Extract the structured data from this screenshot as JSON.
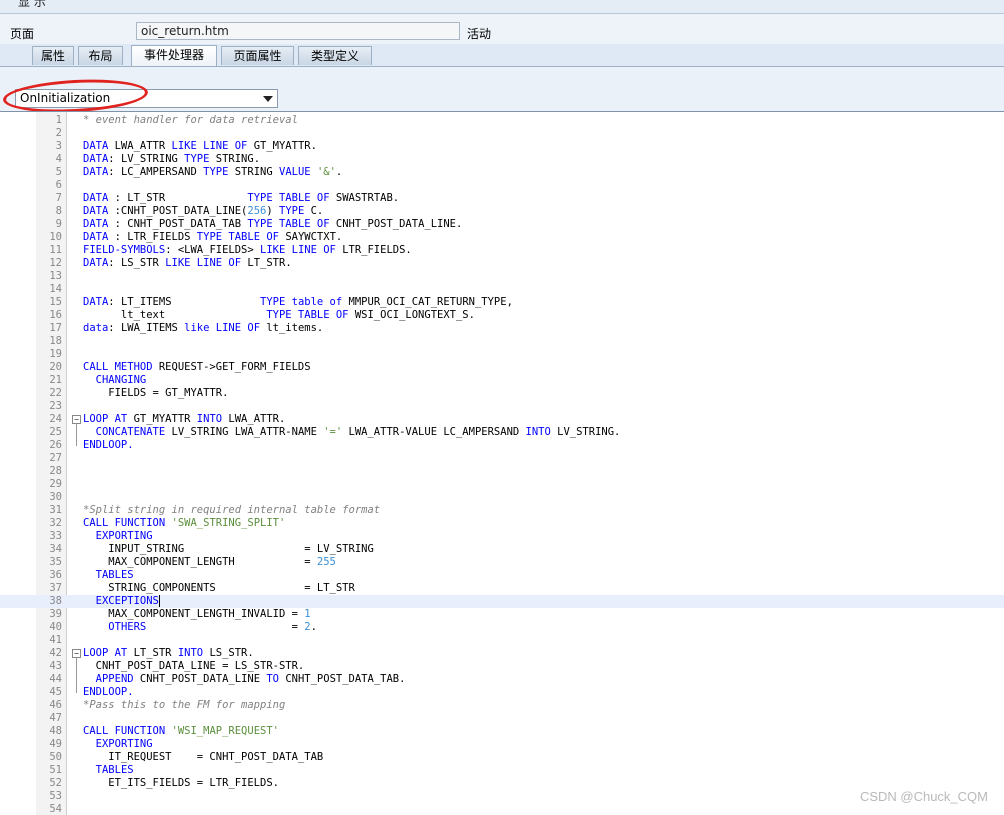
{
  "window": {
    "title": "显 示"
  },
  "header": {
    "page_label": "页面",
    "page_value": "oic_return.htm",
    "status": "活动"
  },
  "tabs": [
    {
      "label": "属性",
      "active": false
    },
    {
      "label": "布局",
      "active": false
    },
    {
      "label": "事件处理器",
      "active": true
    },
    {
      "label": "页面属性",
      "active": false
    },
    {
      "label": "类型定义",
      "active": false
    }
  ],
  "event_select": {
    "value": "OnInitialization"
  },
  "editor": {
    "cursor_line": 38,
    "lines": [
      {
        "n": "1",
        "segs": [
          [
            "c",
            "* event handler for data retrieval"
          ]
        ]
      },
      {
        "n": "2",
        "segs": []
      },
      {
        "n": "3",
        "segs": [
          [
            "k",
            "DATA "
          ],
          [
            "t",
            "LWA_ATTR "
          ],
          [
            "k",
            "LIKE LINE OF "
          ],
          [
            "t",
            "GT_MYATTR."
          ]
        ]
      },
      {
        "n": "4",
        "segs": [
          [
            "k",
            "DATA"
          ],
          [
            "t",
            ": LV_STRING "
          ],
          [
            "k",
            "TYPE "
          ],
          [
            "t",
            "STRING."
          ]
        ]
      },
      {
        "n": "5",
        "segs": [
          [
            "k",
            "DATA"
          ],
          [
            "t",
            ": LC_AMPERSAND "
          ],
          [
            "k",
            "TYPE "
          ],
          [
            "t",
            "STRING "
          ],
          [
            "k",
            "VALUE "
          ],
          [
            "s",
            "'&'"
          ],
          [
            "t",
            "."
          ]
        ]
      },
      {
        "n": "6",
        "segs": []
      },
      {
        "n": "7",
        "segs": [
          [
            "k",
            "DATA "
          ],
          [
            "t",
            ": LT_STR             "
          ],
          [
            "k",
            "TYPE TABLE OF "
          ],
          [
            "t",
            "SWASTRTAB."
          ]
        ]
      },
      {
        "n": "8",
        "segs": [
          [
            "k",
            "DATA "
          ],
          [
            "t",
            ":CNHT_POST_DATA_LINE("
          ],
          [
            "n",
            "256"
          ],
          [
            "t",
            ") "
          ],
          [
            "k",
            "TYPE "
          ],
          [
            "t",
            "C."
          ]
        ]
      },
      {
        "n": "9",
        "segs": [
          [
            "k",
            "DATA "
          ],
          [
            "t",
            ": CNHT_POST_DATA_TAB "
          ],
          [
            "k",
            "TYPE TABLE OF "
          ],
          [
            "t",
            "CNHT_POST_DATA_LINE."
          ]
        ]
      },
      {
        "n": "10",
        "segs": [
          [
            "k",
            "DATA "
          ],
          [
            "t",
            ": LTR_FIELDS "
          ],
          [
            "k",
            "TYPE TABLE OF "
          ],
          [
            "t",
            "SAYWCTXT."
          ]
        ]
      },
      {
        "n": "11",
        "segs": [
          [
            "k",
            "FIELD-SYMBOLS"
          ],
          [
            "t",
            ": <LWA_FIELDS> "
          ],
          [
            "k",
            "LIKE LINE OF "
          ],
          [
            "t",
            "LTR_FIELDS."
          ]
        ]
      },
      {
        "n": "12",
        "segs": [
          [
            "k",
            "DATA"
          ],
          [
            "t",
            ": LS_STR "
          ],
          [
            "k",
            "LIKE LINE OF "
          ],
          [
            "t",
            "LT_STR."
          ]
        ]
      },
      {
        "n": "13",
        "segs": []
      },
      {
        "n": "14",
        "segs": []
      },
      {
        "n": "15",
        "segs": [
          [
            "k",
            "DATA"
          ],
          [
            "t",
            ": LT_ITEMS              "
          ],
          [
            "k",
            "TYPE table of "
          ],
          [
            "t",
            "MMPUR_OCI_CAT_RETURN_TYPE,"
          ]
        ]
      },
      {
        "n": "16",
        "segs": [
          [
            "t",
            "      lt_text                "
          ],
          [
            "k",
            "TYPE TABLE OF "
          ],
          [
            "t",
            "WSI_OCI_LONGTEXT_S."
          ]
        ]
      },
      {
        "n": "17",
        "segs": [
          [
            "k",
            "data"
          ],
          [
            "t",
            ": LWA_ITEMS "
          ],
          [
            "k",
            "like LINE OF "
          ],
          [
            "t",
            "lt_items."
          ]
        ]
      },
      {
        "n": "18",
        "segs": []
      },
      {
        "n": "19",
        "segs": []
      },
      {
        "n": "20",
        "segs": [
          [
            "k",
            "CALL METHOD "
          ],
          [
            "t",
            "REQUEST->GET_FORM_FIELDS"
          ]
        ]
      },
      {
        "n": "21",
        "segs": [
          [
            "t",
            "  "
          ],
          [
            "k",
            "CHANGING"
          ]
        ]
      },
      {
        "n": "22",
        "segs": [
          [
            "t",
            "    FIELDS = GT_MYATTR."
          ]
        ]
      },
      {
        "n": "23",
        "segs": []
      },
      {
        "n": "24",
        "segs": [
          [
            "k",
            "LOOP AT "
          ],
          [
            "t",
            "GT_MYATTR "
          ],
          [
            "k",
            "INTO "
          ],
          [
            "t",
            "LWA_ATTR."
          ]
        ]
      },
      {
        "n": "25",
        "segs": [
          [
            "t",
            "  "
          ],
          [
            "k",
            "CONCATENATE "
          ],
          [
            "t",
            "LV_STRING LWA_ATTR-NAME "
          ],
          [
            "s",
            "'='"
          ],
          [
            "t",
            " LWA_ATTR-VALUE LC_AMPERSAND "
          ],
          [
            "k",
            "INTO "
          ],
          [
            "t",
            "LV_STRING."
          ]
        ]
      },
      {
        "n": "26",
        "segs": [
          [
            "k",
            "ENDLOOP."
          ]
        ]
      },
      {
        "n": "27",
        "segs": []
      },
      {
        "n": "28",
        "segs": []
      },
      {
        "n": "29",
        "segs": []
      },
      {
        "n": "30",
        "segs": []
      },
      {
        "n": "31",
        "segs": [
          [
            "c",
            "*Split string in required internal table format"
          ]
        ]
      },
      {
        "n": "32",
        "segs": [
          [
            "k",
            "CALL FUNCTION "
          ],
          [
            "s",
            "'SWA_STRING_SPLIT'"
          ]
        ]
      },
      {
        "n": "33",
        "segs": [
          [
            "t",
            "  "
          ],
          [
            "k",
            "EXPORTING"
          ]
        ]
      },
      {
        "n": "34",
        "segs": [
          [
            "t",
            "    INPUT_STRING                   = LV_STRING"
          ]
        ]
      },
      {
        "n": "35",
        "segs": [
          [
            "t",
            "    MAX_COMPONENT_LENGTH           = "
          ],
          [
            "n",
            "255"
          ]
        ]
      },
      {
        "n": "36",
        "segs": [
          [
            "t",
            "  "
          ],
          [
            "k",
            "TABLES"
          ]
        ]
      },
      {
        "n": "37",
        "segs": [
          [
            "t",
            "    STRING_COMPONENTS              = LT_STR"
          ]
        ]
      },
      {
        "n": "38",
        "segs": [
          [
            "t",
            "  "
          ],
          [
            "k",
            "EXCEPTIONS"
          ]
        ]
      },
      {
        "n": "39",
        "segs": [
          [
            "t",
            "    MAX_COMPONENT_LENGTH_INVALID = "
          ],
          [
            "n",
            "1"
          ]
        ]
      },
      {
        "n": "40",
        "segs": [
          [
            "t",
            "    "
          ],
          [
            "k",
            "OTHERS"
          ],
          [
            "t",
            "                       = "
          ],
          [
            "n",
            "2"
          ],
          [
            "t",
            "."
          ]
        ]
      },
      {
        "n": "41",
        "segs": []
      },
      {
        "n": "42",
        "segs": [
          [
            "k",
            "LOOP AT "
          ],
          [
            "t",
            "LT_STR "
          ],
          [
            "k",
            "INTO "
          ],
          [
            "t",
            "LS_STR."
          ]
        ]
      },
      {
        "n": "43",
        "segs": [
          [
            "t",
            "  CNHT_POST_DATA_LINE = LS_STR-STR."
          ]
        ]
      },
      {
        "n": "44",
        "segs": [
          [
            "t",
            "  "
          ],
          [
            "k",
            "APPEND "
          ],
          [
            "t",
            "CNHT_POST_DATA_LINE "
          ],
          [
            "k",
            "TO "
          ],
          [
            "t",
            "CNHT_POST_DATA_TAB."
          ]
        ]
      },
      {
        "n": "45",
        "segs": [
          [
            "k",
            "ENDLOOP."
          ]
        ]
      },
      {
        "n": "46",
        "segs": [
          [
            "c",
            "*Pass this to the FM for mapping"
          ]
        ]
      },
      {
        "n": "47",
        "segs": []
      },
      {
        "n": "48",
        "segs": [
          [
            "k",
            "CALL FUNCTION "
          ],
          [
            "s",
            "'WSI_MAP_REQUEST'"
          ]
        ]
      },
      {
        "n": "49",
        "segs": [
          [
            "t",
            "  "
          ],
          [
            "k",
            "EXPORTING"
          ]
        ]
      },
      {
        "n": "50",
        "segs": [
          [
            "t",
            "    IT_REQUEST    = CNHT_POST_DATA_TAB"
          ]
        ]
      },
      {
        "n": "51",
        "segs": [
          [
            "t",
            "  "
          ],
          [
            "k",
            "TABLES"
          ]
        ]
      },
      {
        "n": "52",
        "segs": [
          [
            "t",
            "    ET_ITS_FIELDS = LTR_FIELDS."
          ]
        ]
      },
      {
        "n": "53",
        "segs": []
      },
      {
        "n": "54",
        "segs": []
      }
    ]
  },
  "watermark": "CSDN @Chuck_CQM"
}
